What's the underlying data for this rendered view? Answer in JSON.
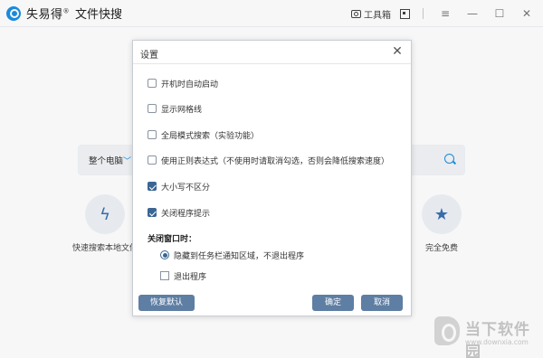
{
  "app": {
    "name": "失易得",
    "name_mark": "®",
    "subtitle": "文件快搜",
    "toolbox_label": "工具箱"
  },
  "search": {
    "scope_label": "整个电脑",
    "scope_chevron": "﹀"
  },
  "features": [
    {
      "label": "快速搜索本地文件",
      "icon": "lightning-icon"
    },
    {
      "label": "完全免费",
      "icon": "star-icon"
    }
  ],
  "dialog": {
    "title": "设置",
    "options": [
      {
        "label": "开机时自动启动",
        "checked": false
      },
      {
        "label": "显示网格线",
        "checked": false
      },
      {
        "label": "全局模式搜索（实验功能）",
        "checked": false
      },
      {
        "label": "使用正则表达式（不使用时请取消勾选，否则会降低搜索速度）",
        "checked": false
      },
      {
        "label": "大小写不区分",
        "checked": true
      },
      {
        "label": "关闭程序提示",
        "checked": true
      }
    ],
    "close_section_label": "关闭窗口时：",
    "close_choices": [
      {
        "label": "隐藏到任务栏通知区域，不退出程序",
        "selected": true
      },
      {
        "label": "退出程序",
        "selected": false
      }
    ],
    "buttons": {
      "reset": "恢复默认",
      "ok": "确定",
      "cancel": "取消"
    }
  },
  "watermark": {
    "title": "当下软件园",
    "url": "www.downxia.com"
  },
  "colors": {
    "accent": "#1a8fe3",
    "dialog_button": "#5e7ea3",
    "checked": "#3a6694"
  }
}
